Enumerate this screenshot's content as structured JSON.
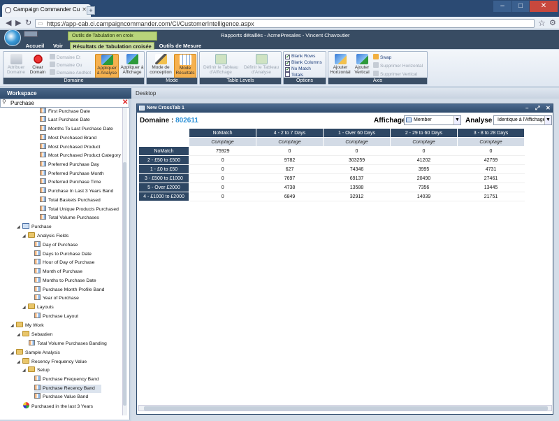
{
  "browser": {
    "tab_title": "Campaign Commander Cu",
    "new_tab": "+",
    "url": "https://app-cab.ci.campaigncommander.com/CI/CustomerIntelligence.aspx",
    "url_prefix": "https://",
    "win_min": "–",
    "win_max": "□",
    "win_close": "✕"
  },
  "header": {
    "context_group": "Outils de Tabulation en croix",
    "report_info": "Rapports détaillés - AcmePresales - Vincent Chavoutier",
    "tabs": [
      {
        "label": "Accueil"
      },
      {
        "label": "Voir"
      },
      {
        "label": "Résultats de Tabulation croisée"
      },
      {
        "label": "Outils de Mesure"
      }
    ]
  },
  "ribbon": {
    "domaine": {
      "label": "Domaine",
      "attribuer": "Attribuer Domaine",
      "clear": "Clear Domain",
      "et": "Domaine Et",
      "ou": "Domaine Ou",
      "andnot": "Domaine AndNot",
      "appliquer_analyse": "Appliquer à Analyse",
      "appliquer_affichage": "Appliquer à Affichage"
    },
    "mode": {
      "label": "Mode",
      "conception": "Mode de conception",
      "resultats": "Mode Résultats"
    },
    "table_levels": {
      "label": "Table Levels",
      "def_affichage": "Définir le Tableau d'Affichage",
      "def_analyse": "Définir le Tableau d'Analyse"
    },
    "options": {
      "label": "Options",
      "blank_rows": "Blank Rows",
      "blank_columns": "Blank Columns",
      "no_match": "No Match",
      "totals": "Totals"
    },
    "axis": {
      "label": "Axis",
      "ajouter_h": "Ajouter Horizontal",
      "ajouter_v": "Ajouter Vertical",
      "swap": "Swap",
      "suppr_h": "Supprimer Horizontal",
      "suppr_v": "Supprimer Vertical"
    }
  },
  "workspace": {
    "title": "Workspace",
    "search_value": "Purchase",
    "tree": [
      {
        "label": "First Purchase Date"
      },
      {
        "label": "Last Purchase Date"
      },
      {
        "label": "Months To Last Purchase Date"
      },
      {
        "label": "Most Purchased Brand"
      },
      {
        "label": "Most Purchased Product"
      },
      {
        "label": "Most Purchased Product Category"
      },
      {
        "label": "Preferred Purchase Day"
      },
      {
        "label": "Preferred Purchase Month"
      },
      {
        "label": "Preferred Purchase Time"
      },
      {
        "label": "Purchase In Last 3 Years Band"
      },
      {
        "label": "Total Baskets Purchased"
      },
      {
        "label": "Total Unique Products Purchased"
      },
      {
        "label": "Total Volume Purchases"
      },
      {
        "label": "Purchase"
      },
      {
        "label": "Analysis Fields"
      },
      {
        "label": "Day of Purchase"
      },
      {
        "label": "Days to Purchase Date"
      },
      {
        "label": "Hour of Day of Purchase"
      },
      {
        "label": "Month of Purchase"
      },
      {
        "label": "Months to Purchase Date"
      },
      {
        "label": "Purchase Month Profile Band"
      },
      {
        "label": "Year of Purchase"
      },
      {
        "label": "Layouts"
      },
      {
        "label": "Purchase Layout"
      },
      {
        "label": "My Work"
      },
      {
        "label": "Sebastien"
      },
      {
        "label": "Total Volume Purchases Banding"
      },
      {
        "label": "Sample Analysis"
      },
      {
        "label": "Recency Frequency Value"
      },
      {
        "label": "Setup"
      },
      {
        "label": "Purchase Frequency Band"
      },
      {
        "label": "Purchase Recency Band"
      },
      {
        "label": "Purchase Value Band"
      },
      {
        "label": "Purchased in the last 3 Years"
      }
    ]
  },
  "desktop": {
    "title": "Desktop",
    "window_title": "New CrossTab 1",
    "domain_label": "Domaine :",
    "domain_value": "802611",
    "affichage_label": "Affichage :",
    "affichage_value": "Member",
    "analyse_label": "Analyse :",
    "analyse_value": "Identique à l'Affichage",
    "dropdown_arrow": "▼"
  },
  "crosstab": {
    "columns": [
      "NoMatch",
      "4 - 2 to 7 Days",
      "1 - Over 60 Days",
      "2 - 29 to 60 Days",
      "3 - 8 to 28 Days"
    ],
    "subheader": "Comptage",
    "rows": [
      {
        "label": "NoMatch",
        "values": [
          "75929",
          "0",
          "0",
          "0",
          "0"
        ]
      },
      {
        "label": "2 - £50 to £500",
        "values": [
          "0",
          "9782",
          "303259",
          "41202",
          "42759"
        ]
      },
      {
        "label": "1 - £0 to £50",
        "values": [
          "0",
          "627",
          "74346",
          "3995",
          "4731"
        ]
      },
      {
        "label": "3 - £500 to £1000",
        "values": [
          "0",
          "7697",
          "69137",
          "20490",
          "27461"
        ]
      },
      {
        "label": "5 - Over £2000",
        "values": [
          "0",
          "4738",
          "13588",
          "7356",
          "13445"
        ]
      },
      {
        "label": "4 - £1000 to £2000",
        "values": [
          "0",
          "6849",
          "32912",
          "14039",
          "21751"
        ]
      }
    ]
  }
}
